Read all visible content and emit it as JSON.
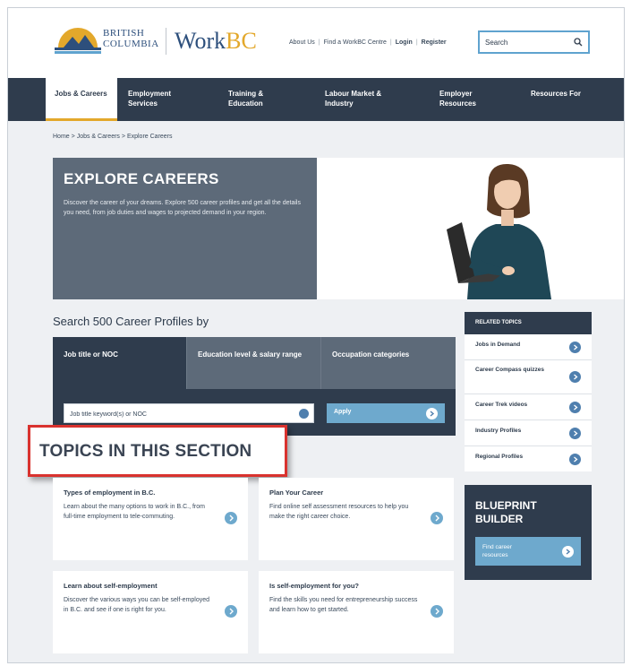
{
  "header": {
    "bc_line1": "British",
    "bc_line2": "Columbia",
    "workbc_work": "Work",
    "workbc_bc": "BC",
    "links": [
      "About Us",
      "Find a WorkBC Centre",
      "Login",
      "Register"
    ],
    "search_placeholder": "Search"
  },
  "nav": {
    "items": [
      {
        "label": "Jobs & Careers"
      },
      {
        "label": "Employment Services"
      },
      {
        "label": "Training & Education"
      },
      {
        "label": "Labour Market & Industry"
      },
      {
        "label": "Employer Resources"
      },
      {
        "label": "Resources For"
      }
    ]
  },
  "breadcrumb": {
    "items": [
      "Home",
      "Jobs & Careers",
      "Explore Careers"
    ],
    "separator": ">"
  },
  "hero": {
    "title": "EXPLORE CAREERS",
    "description": "Discover the career of your dreams. Explore 500 career profiles and get all the details you need, from job duties and wages to projected demand in your region."
  },
  "search": {
    "heading": "Search 500 Career Profiles by",
    "tabs": [
      {
        "label": "Job title or NOC"
      },
      {
        "label": "Education level & salary range"
      },
      {
        "label": "Occupation categories"
      }
    ],
    "input_placeholder": "Job title keyword(s) or NOC",
    "apply_label": "Apply"
  },
  "callout": {
    "label": "TOPICS IN THIS SECTION"
  },
  "cards": [
    {
      "title": "Types of employment in B.C.",
      "text": "Learn about the many options to work in B.C., from full-time employment to tele-commuting."
    },
    {
      "title": "Plan Your Career",
      "text": "Find online self assessment resources to help you make the right career choice."
    },
    {
      "title": "Learn about self-employment",
      "text": "Discover the various ways you can be self-employed in B.C. and see if one is right for you."
    },
    {
      "title": "Is self-employment for you?",
      "text": "Find the skills you need for entrepreneurship success and learn how to get started."
    }
  ],
  "related": {
    "heading": "RELATED TOPICS",
    "items": [
      {
        "label": "Jobs in Demand"
      },
      {
        "label": "Career Compass quizzes"
      },
      {
        "label": "Career Trek videos"
      },
      {
        "label": "Industry Profiles"
      },
      {
        "label": "Regional Profiles"
      }
    ]
  },
  "blueprint": {
    "title": "BLUEPRINT BUILDER",
    "button_label": "Find career resources"
  },
  "colors": {
    "navy": "#2f3c4d",
    "slate": "#5d6a79",
    "accent_blue": "#6ea9cd",
    "gold": "#e3a82b",
    "callout_red": "#d9322e"
  }
}
